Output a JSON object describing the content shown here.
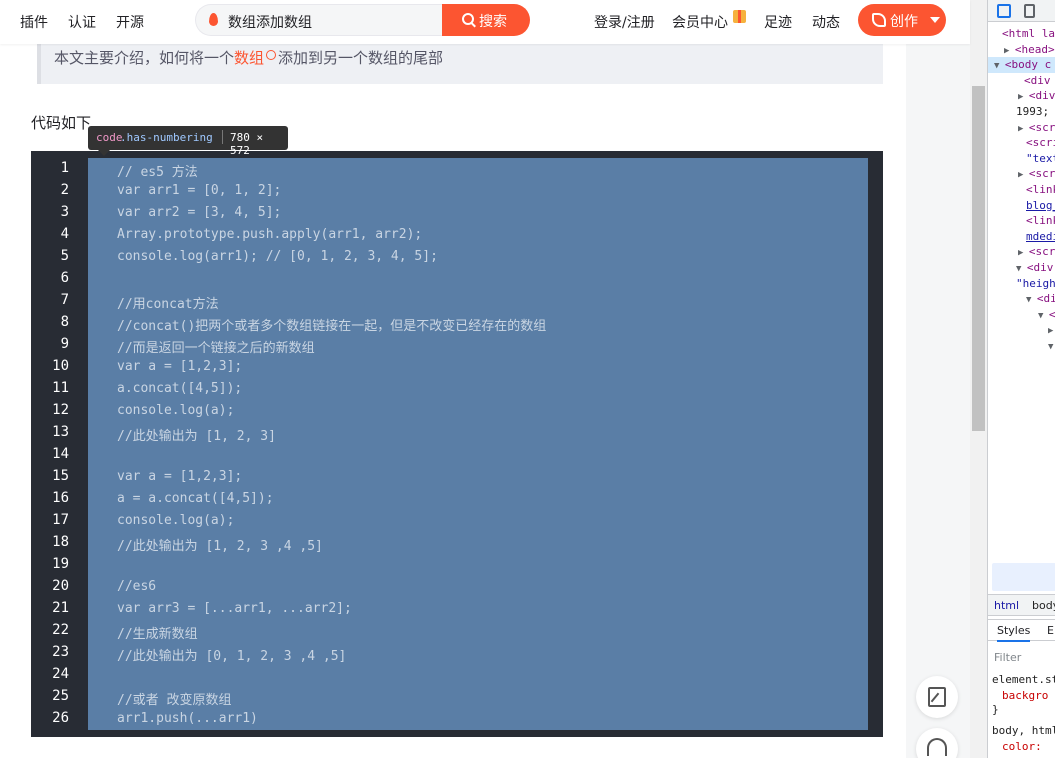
{
  "nav": {
    "links": [
      "插件",
      "认证",
      "开源"
    ],
    "search_query": "数组添加数组",
    "search_button": "搜索",
    "right_links": [
      "登录/注册",
      "会员中心",
      "足迹",
      "动态"
    ],
    "create_button": "创作"
  },
  "article": {
    "summary_before": "本文主要介绍，如何将一个",
    "summary_link": "数组",
    "summary_after": "添加到另一个数组的尾部",
    "intro": "代码如下",
    "tooltip": {
      "tag": "code",
      "cls": ".has-numbering",
      "size": "780 × 572"
    },
    "code_lines": [
      "// es5 方法",
      "var arr1 = [0, 1, 2];",
      "var arr2 = [3, 4, 5];",
      "Array.prototype.push.apply(arr1, arr2);",
      "console.log(arr1); // [0, 1, 2, 3, 4, 5];",
      "",
      "//用concat方法",
      "//concat()把两个或者多个数组链接在一起，但是不改变已经存在的数组",
      "//而是返回一个链接之后的新数组",
      "var a = [1,2,3];",
      "a.concat([4,5]);",
      "console.log(a);",
      "//此处输出为 [1, 2, 3]",
      "",
      "var a = [1,2,3];",
      "a = a.concat([4,5]);",
      "console.log(a);",
      "//此处输出为 [1, 2, 3 ,4 ,5]",
      "",
      "//es6",
      "var arr3 = [...arr1, ...arr2];",
      "//生成新数组",
      "//此处输出为 [0, 1, 2, 3 ,4 ,5]",
      "",
      "//或者 改变原数组",
      "arr1.push(...arr1)"
    ]
  },
  "devtools": {
    "lines": [
      {
        "tri": "",
        "a": "<html la",
        "b": "",
        "c": ""
      },
      {
        "tri": "▶",
        "a": "<head>",
        "b": "",
        "c": "…"
      },
      {
        "tri": "▼",
        "a": "<body c",
        "b": "",
        "c": ""
      },
      {
        "tri": "",
        "a": "<div",
        "b": "",
        "c": ""
      },
      {
        "tri": "▶",
        "a": "<div",
        "b": "",
        "c": ""
      },
      {
        "tri": "",
        "a": "",
        "b": "",
        "c": "1993;"
      },
      {
        "tri": "▶",
        "a": "<scri",
        "b": "",
        "c": ""
      },
      {
        "tri": "",
        "a": "<scri",
        "b": "",
        "c": ""
      },
      {
        "tri": "",
        "a": "",
        "b": "\"text",
        "c": ""
      },
      {
        "tri": "▶",
        "a": "<scri",
        "b": "",
        "c": ""
      },
      {
        "tri": "",
        "a": "<link",
        "b": "",
        "c": ""
      },
      {
        "tri": "",
        "a": "",
        "b": "blog_",
        "c": ""
      },
      {
        "tri": "",
        "a": "<link",
        "b": "",
        "c": ""
      },
      {
        "tri": "",
        "a": "",
        "b": "mdedi",
        "c": ""
      },
      {
        "tri": "▶",
        "a": "<scri",
        "b": "",
        "c": ""
      },
      {
        "tri": "▼",
        "a": "<div",
        "b": "",
        "c": ""
      },
      {
        "tri": "",
        "a": "",
        "b": "\"heigh",
        "c": ""
      },
      {
        "tri": "▼",
        "a": "<di",
        "b": "",
        "c": ""
      },
      {
        "tri": "▼",
        "a": "<",
        "b": "",
        "c": ""
      },
      {
        "tri": "▶",
        "a": "",
        "b": "",
        "c": ""
      },
      {
        "tri": "▼",
        "a": "",
        "b": "",
        "c": ""
      }
    ],
    "breadcrumb": [
      "html",
      "body"
    ],
    "tabs": [
      "Styles",
      "E"
    ],
    "filter_placeholder": "Filter",
    "style_lines": [
      "element.st",
      "backgro",
      "}",
      "body, html",
      "color:"
    ]
  }
}
